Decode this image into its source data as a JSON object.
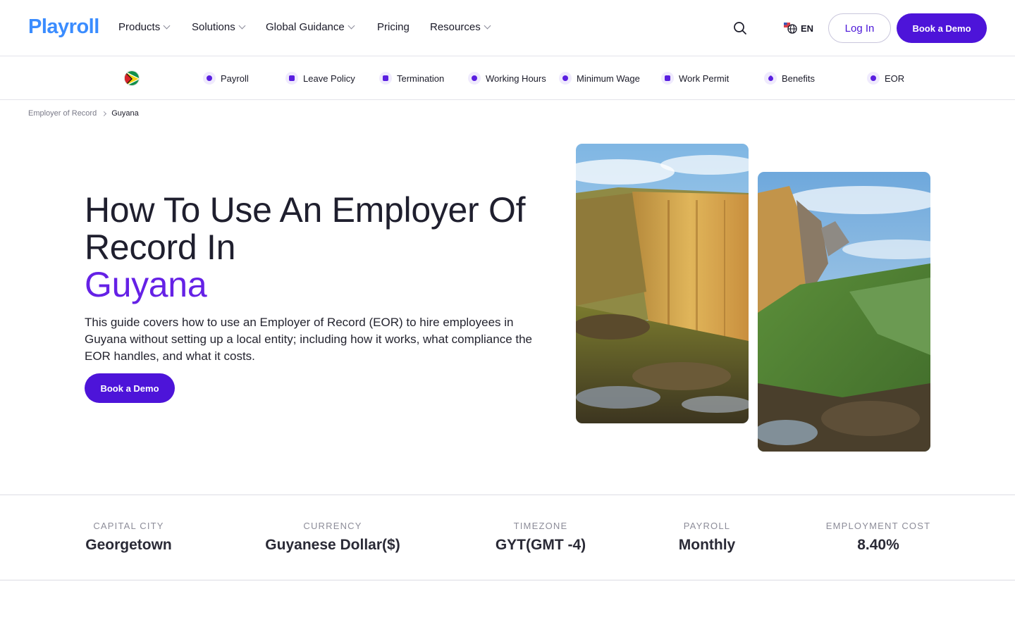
{
  "brand": {
    "logo": "Playroll"
  },
  "nav": {
    "items": [
      {
        "label": "Products",
        "dropdown": true
      },
      {
        "label": "Solutions",
        "dropdown": true
      },
      {
        "label": "Global Guidance",
        "dropdown": true
      },
      {
        "label": "Pricing",
        "dropdown": false
      },
      {
        "label": "Resources",
        "dropdown": true
      }
    ],
    "language": "EN",
    "login": "Log In",
    "demo": "Book a Demo"
  },
  "subnav": {
    "items": [
      {
        "label": "Payroll",
        "icon": "payroll-icon"
      },
      {
        "label": "Leave Policy",
        "icon": "leave-policy-icon"
      },
      {
        "label": "Termination",
        "icon": "termination-icon"
      },
      {
        "label": "Working Hours",
        "icon": "working-hours-icon"
      },
      {
        "label": "Minimum Wage",
        "icon": "minimum-wage-icon"
      },
      {
        "label": "Work Permit",
        "icon": "work-permit-icon"
      },
      {
        "label": "Benefits",
        "icon": "benefits-icon"
      },
      {
        "label": "EOR",
        "icon": "eor-icon"
      }
    ]
  },
  "breadcrumb": {
    "parent": "Employer of Record",
    "current": "Guyana"
  },
  "hero": {
    "title": "How To Use An Employer Of Record In",
    "country": "Guyana",
    "description": "This guide covers how to use an Employer of Record (EOR) to hire employees in Guyana without setting up a local entity; including how it works, what compliance the EOR handles, and what it costs.",
    "cta": "Book a Demo"
  },
  "stats": [
    {
      "label": "CAPITAL CITY",
      "value": "Georgetown"
    },
    {
      "label": "CURRENCY",
      "value": "Guyanese Dollar($)"
    },
    {
      "label": "TIMEZONE",
      "value": "GYT(GMT -4)"
    },
    {
      "label": "PAYROLL",
      "value": "Monthly"
    },
    {
      "label": "EMPLOYMENT COST",
      "value": "8.40%"
    }
  ],
  "colors": {
    "accent": "#4d14d9",
    "accent_text": "#6521e6",
    "logo": "#3a8cff"
  }
}
